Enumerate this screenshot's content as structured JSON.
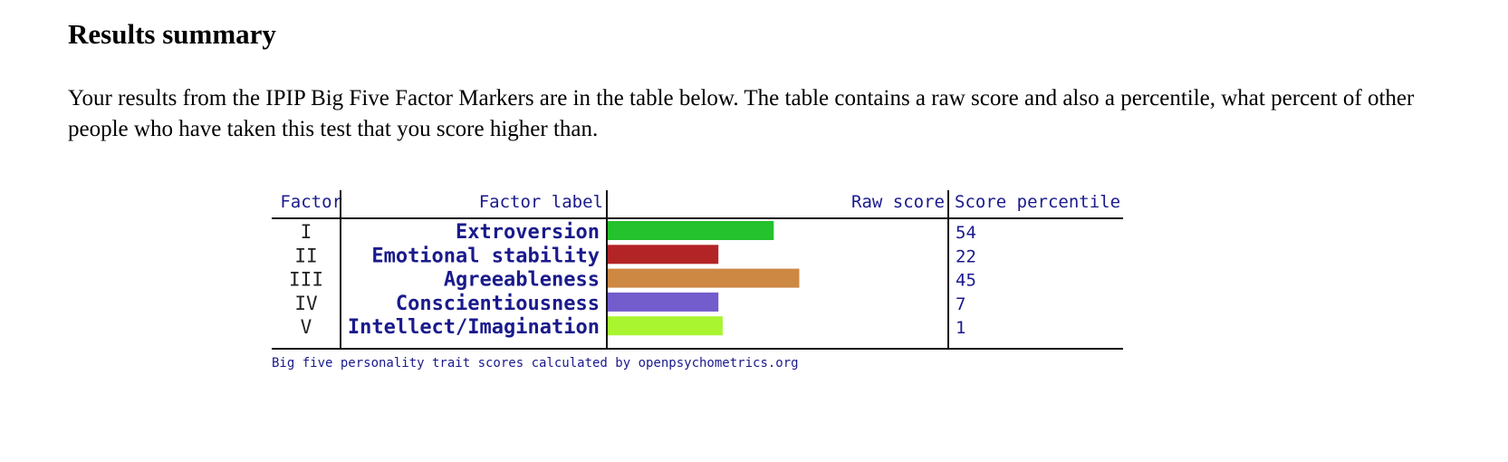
{
  "page": {
    "title": "Results summary",
    "intro": "Your results from the IPIP Big Five Factor Markers are in the table below. The table contains a raw score and also a percentile, what percent of other people who have taken this test that you score higher than."
  },
  "chart_data": {
    "type": "bar",
    "orientation": "horizontal",
    "headers": [
      "Factor",
      "Factor label",
      "Raw score",
      "Score percentile"
    ],
    "factors": [
      "I",
      "II",
      "III",
      "IV",
      "V"
    ],
    "categories": [
      "Extroversion",
      "Emotional stability",
      "Agreeableness",
      "Conscientiousness",
      "Intellect/Imagination"
    ],
    "values": [
      54,
      22,
      45,
      7,
      1
    ],
    "raw_scores": [
      39,
      26,
      45,
      26,
      27
    ],
    "raw_score_range": [
      0,
      80
    ],
    "colors": [
      "#24c22c",
      "#b32426",
      "#cd8844",
      "#735ccc",
      "#a8f530"
    ],
    "footnote": "Big five personality trait scores calculated by openpsychometrics.org",
    "grid": false,
    "legend": "none"
  }
}
